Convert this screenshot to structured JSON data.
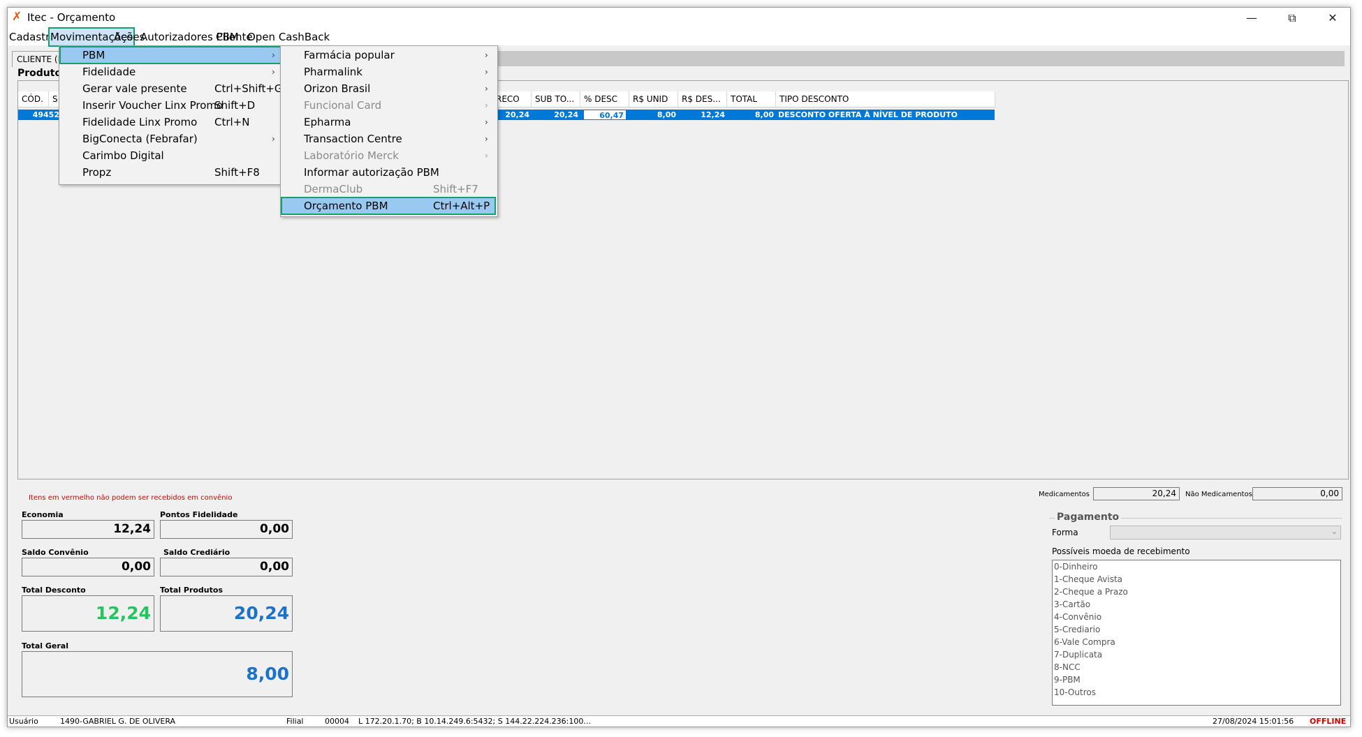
{
  "window": {
    "title": "Itec - Orçamento",
    "minimize": "—",
    "restore": "⧉",
    "close": "✕"
  },
  "menubar": [
    "Cadastros",
    "Movimentações",
    "Ações",
    "Autorizadores PBM",
    "Cliente",
    "Open CashBack"
  ],
  "tabs": {
    "cliente": "CLIENTE (F",
    "produtos": "Produtos"
  },
  "grid": {
    "headers": [
      "CÓD.",
      "S",
      "RECO",
      "SUB TO...",
      "% DESC",
      "R$ UNID",
      "R$ DES...",
      "TOTAL",
      "TIPO DESCONTO"
    ],
    "row": {
      "cod": "49452",
      "preco": "20,24",
      "subtotal": "20,24",
      "desc_pct": "60,47",
      "unid": "8,00",
      "rs_desc": "12,24",
      "total": "8,00",
      "tipo": "DESCONTO OFERTA À NÍVEL DE PRODUTO"
    }
  },
  "movimentacoes_menu": [
    {
      "label": "PBM",
      "shortcut": "",
      "arrow": "›"
    },
    {
      "label": "Fidelidade",
      "shortcut": "",
      "arrow": "›"
    },
    {
      "label": "Gerar vale presente",
      "shortcut": "Ctrl+Shift+G",
      "arrow": ""
    },
    {
      "label": "Inserir Voucher Linx Promo",
      "shortcut": "Shift+D",
      "arrow": ""
    },
    {
      "label": "Fidelidade Linx Promo",
      "shortcut": "Ctrl+N",
      "arrow": ""
    },
    {
      "label": "BigConecta (Febrafar)",
      "shortcut": "",
      "arrow": "›"
    },
    {
      "label": "Carimbo Digital",
      "shortcut": "",
      "arrow": ""
    },
    {
      "label": "Propz",
      "shortcut": "Shift+F8",
      "arrow": ""
    }
  ],
  "pbm_menu": [
    {
      "label": "Farmácia popular",
      "shortcut": "",
      "arrow": "›"
    },
    {
      "label": "Pharmalink",
      "shortcut": "",
      "arrow": "›"
    },
    {
      "label": "Orizon Brasil",
      "shortcut": "",
      "arrow": "›"
    },
    {
      "label": "Funcional Card",
      "shortcut": "",
      "arrow": "›"
    },
    {
      "label": "Epharma",
      "shortcut": "",
      "arrow": "›"
    },
    {
      "label": "Transaction Centre",
      "shortcut": "",
      "arrow": "›"
    },
    {
      "label": "Laboratório Merck",
      "shortcut": "",
      "arrow": "›"
    },
    {
      "label": "Informar autorização PBM",
      "shortcut": "",
      "arrow": ""
    },
    {
      "label": "DermaClub",
      "shortcut": "Shift+F7",
      "arrow": ""
    },
    {
      "label": "Orçamento PBM",
      "shortcut": "Ctrl+Alt+P",
      "arrow": ""
    }
  ],
  "summary": {
    "notice": "Itens em vermelho não podem ser recebidos em convênio",
    "economia_label": "Economia",
    "economia": "12,24",
    "pontos_label": "Pontos Fidelidade",
    "pontos": "0,00",
    "saldo_convenio_label": "Saldo Convênio",
    "saldo_convenio": "0,00",
    "saldo_crediario_label": "Saldo Crediário",
    "saldo_crediario": "0,00",
    "total_desconto_label": "Total Desconto",
    "total_desconto": "12,24",
    "total_produtos_label": "Total Produtos",
    "total_produtos": "20,24",
    "total_geral_label": "Total Geral",
    "total_geral": "8,00"
  },
  "colors": {
    "accent": "#13a06b",
    "selection": "#0078d7",
    "green_value": "#22c55e",
    "blue_value": "#1a73c8",
    "offline": "#d40000"
  },
  "right": {
    "medicamentos_label": "Medicamentos",
    "medicamentos": "20,24",
    "nao_medicamentos_label": "Não Medicamentos",
    "nao_medicamentos": "0,00",
    "pagamento_label": "Pagamento",
    "forma_label": "Forma",
    "moedas_label": "Possíveis moeda de recebimento",
    "moedas": [
      "0-Dinheiro",
      "1-Cheque Avista",
      "2-Cheque a Prazo",
      "3-Cartão",
      "4-Convênio",
      "5-Crediario",
      "6-Vale Compra",
      "7-Duplicata",
      "8-NCC",
      "9-PBM",
      "10-Outros"
    ]
  },
  "status": {
    "usuario_label": "Usuário",
    "usuario": "1490-GABRIEL G. DE OLIVERA",
    "filial_label": "Filial",
    "filial": "00004",
    "ips": "L 172.20.1.70; B 10.14.249.6:5432; S 144.22.224.236:100...",
    "datetime": "27/08/2024 15:01:56",
    "mode": "OFFLINE"
  }
}
